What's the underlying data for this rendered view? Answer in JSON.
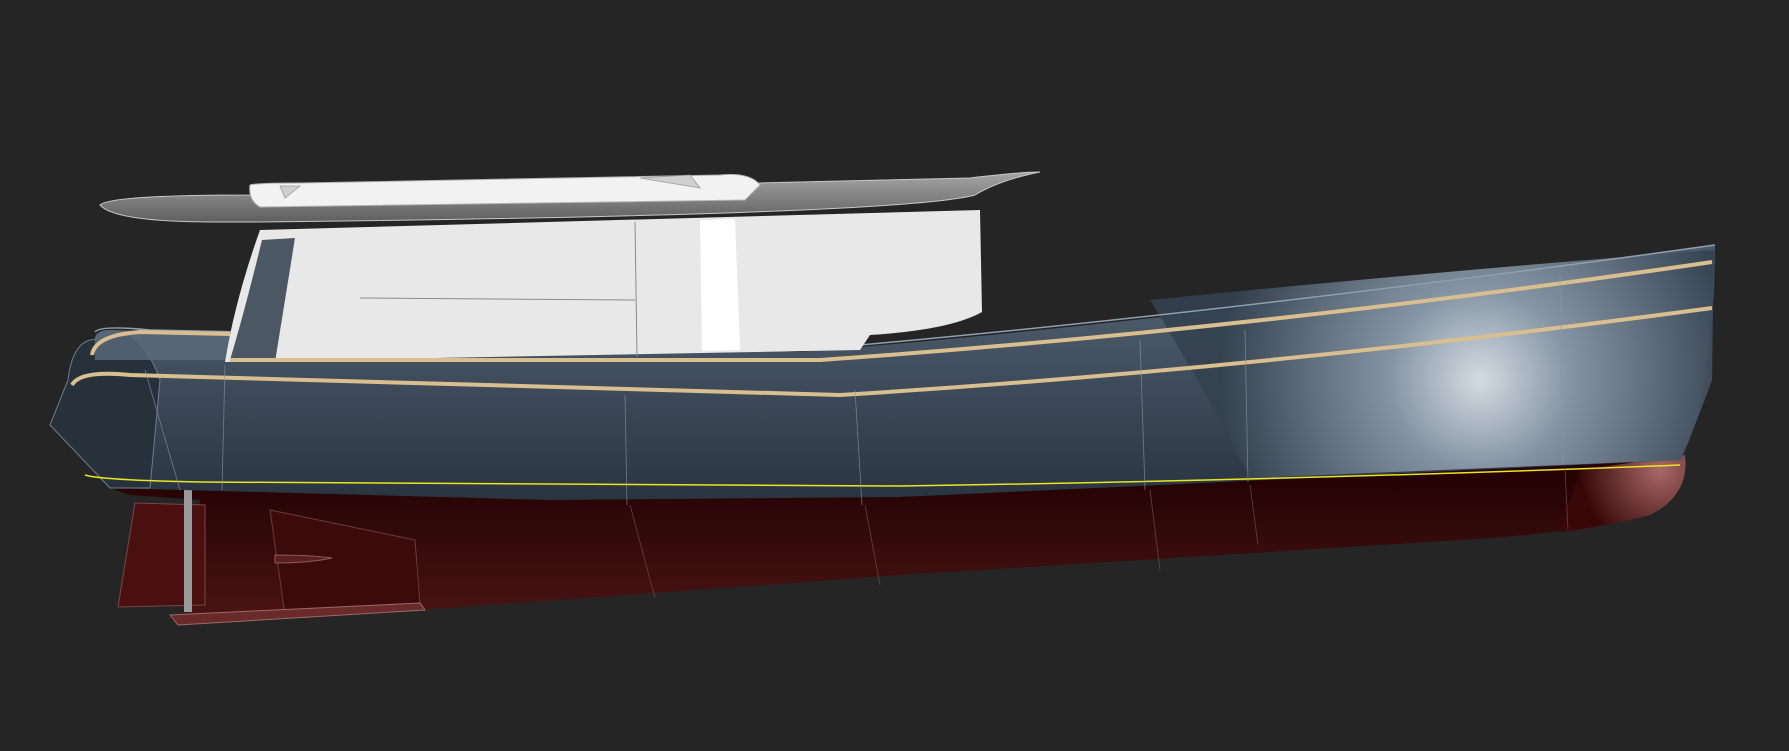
{
  "colors": {
    "background": "#252525",
    "hull_topsides": "#34414f",
    "hull_highlight": "#dfe8ef",
    "bottom_paint": "#3a0808",
    "superstructure": "#ebebeb",
    "roof": "#8a8a8a",
    "rub_rail": "#d9bf8f",
    "waterline": "#e8e620"
  },
  "scene": {
    "view": "side-profile",
    "subject": "motor-boat-hull-render"
  }
}
